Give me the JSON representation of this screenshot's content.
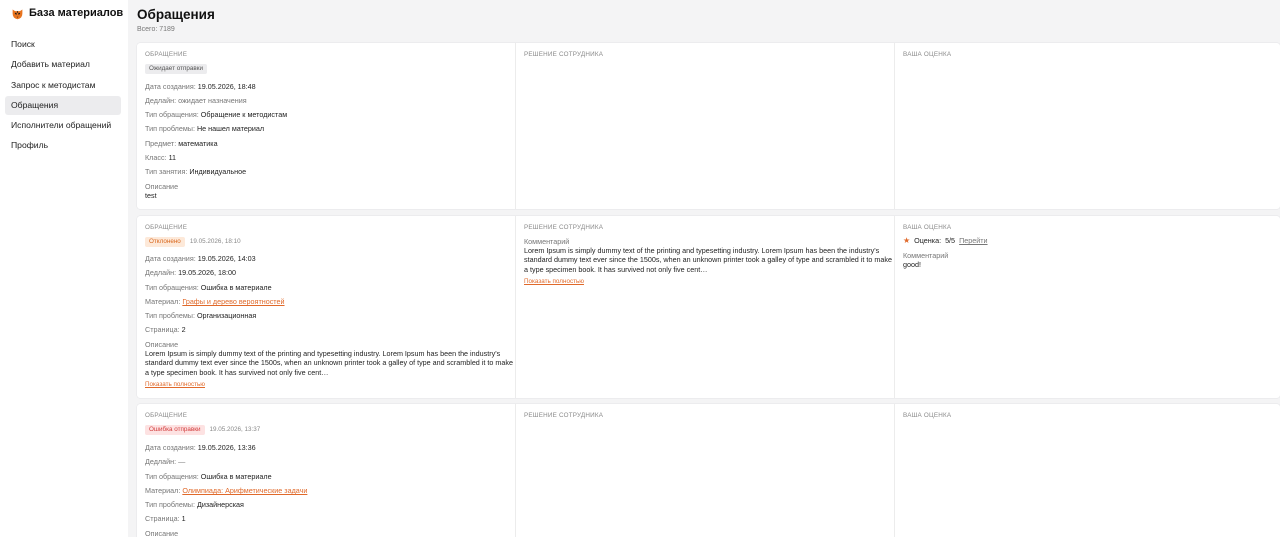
{
  "brand": {
    "name": "База материалов",
    "logo_icon": "tiger-logo-icon"
  },
  "nav": {
    "items": [
      {
        "label": "Поиск",
        "active": false
      },
      {
        "label": "Добавить материал",
        "active": false
      },
      {
        "label": "Запрос к методистам",
        "active": false
      },
      {
        "label": "Обращения",
        "active": true
      },
      {
        "label": "Исполнители обращений",
        "active": false
      },
      {
        "label": "Профиль",
        "active": false
      }
    ]
  },
  "page": {
    "title": "Обращения",
    "total": "Всего: 7189"
  },
  "columns": {
    "request": "ОБРАЩЕНИЕ",
    "decision": "РЕШЕНИЕ СОТРУДНИКА",
    "rating": "ВАША ОЦЕНКА"
  },
  "labels": {
    "created": "Дата создания:",
    "deadline": "Дедлайн:",
    "type": "Тип обращения:",
    "problem": "Тип проблемы:",
    "subject": "Предмет:",
    "grade": "Класс:",
    "lesson": "Тип занятия:",
    "material": "Материал:",
    "page": "Страница:",
    "description": "Описание",
    "comment": "Комментарий",
    "show_more": "Показать полностью",
    "rating": "Оценка:",
    "goto": "Перейти"
  },
  "cards": [
    {
      "status": "Ожидает отправки",
      "status_date": "",
      "created": "19.05.2026, 18:48",
      "deadline": "ожидает назначения",
      "type": "Обращение к методистам",
      "problem": "Не нашел материал",
      "subject": "математика",
      "grade": "11",
      "lesson": "Индивидуальное",
      "description": "test"
    },
    {
      "status": "Отклонено",
      "status_date": "19.05.2026, 18:10",
      "created": "19.05.2026, 14:03",
      "deadline": "19.05.2026, 18:00",
      "type": "Ошибка в материале",
      "material": "Графы и дерево вероятностей",
      "problem": "Организационная",
      "page": "2",
      "description": "Lorem Ipsum is simply dummy text of the printing and typesetting industry. Lorem Ipsum has been the industry's standard dummy text ever since the 1500s, when an unknown printer took a galley of type and scrambled it to make a type specimen book. It has survived not only five cent…",
      "decision_comment": "Lorem Ipsum is simply dummy text of the printing and typesetting industry. Lorem Ipsum has been the industry's standard dummy text ever since the 1500s, when an unknown printer took a galley of type and scrambled it to make a type specimen book. It has survived not only five cent…",
      "rating_value": "5/5",
      "rating_comment": "good!"
    },
    {
      "status": "Ошибка отправки",
      "status_date": "19.05.2026, 13:37",
      "created": "19.05.2026, 13:36",
      "deadline": "—",
      "type": "Ошибка в материале",
      "material": "Олимпиада: Арифметические задачи",
      "problem": "Дизайнерская",
      "page": "1"
    }
  ],
  "colors": {
    "accent": "#e0692a",
    "rejected_bg": "#fde9d9",
    "error_bg": "#fde2e2",
    "page_bg": "#f4f4f5"
  }
}
